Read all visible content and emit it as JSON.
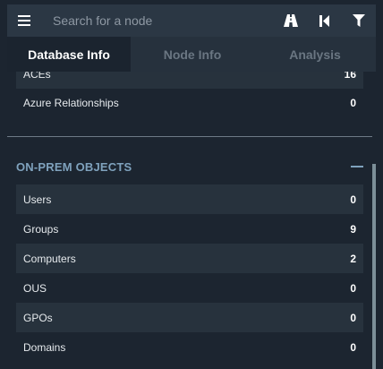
{
  "search": {
    "placeholder": "Search for a node"
  },
  "tabs": [
    {
      "label": "Database Info",
      "active": true
    },
    {
      "label": "Node Info",
      "active": false
    },
    {
      "label": "Analysis",
      "active": false
    }
  ],
  "azure_rows": [
    {
      "label": "ACEs",
      "value": "16"
    },
    {
      "label": "Azure Relationships",
      "value": "0"
    }
  ],
  "onprem": {
    "title": "ON-PREM OBJECTS",
    "rows": [
      {
        "label": "Users",
        "value": "0"
      },
      {
        "label": "Groups",
        "value": "9"
      },
      {
        "label": "Computers",
        "value": "2"
      },
      {
        "label": "OUS",
        "value": "0"
      },
      {
        "label": "GPOs",
        "value": "0"
      },
      {
        "label": "Domains",
        "value": "0"
      }
    ]
  },
  "colors": {
    "accent": "#7fa2bd",
    "topbar": "#2b3744",
    "panel": "#1c2530"
  },
  "icons": [
    "menu-icon",
    "pathfinding-icon",
    "back-icon",
    "filter-icon"
  ]
}
